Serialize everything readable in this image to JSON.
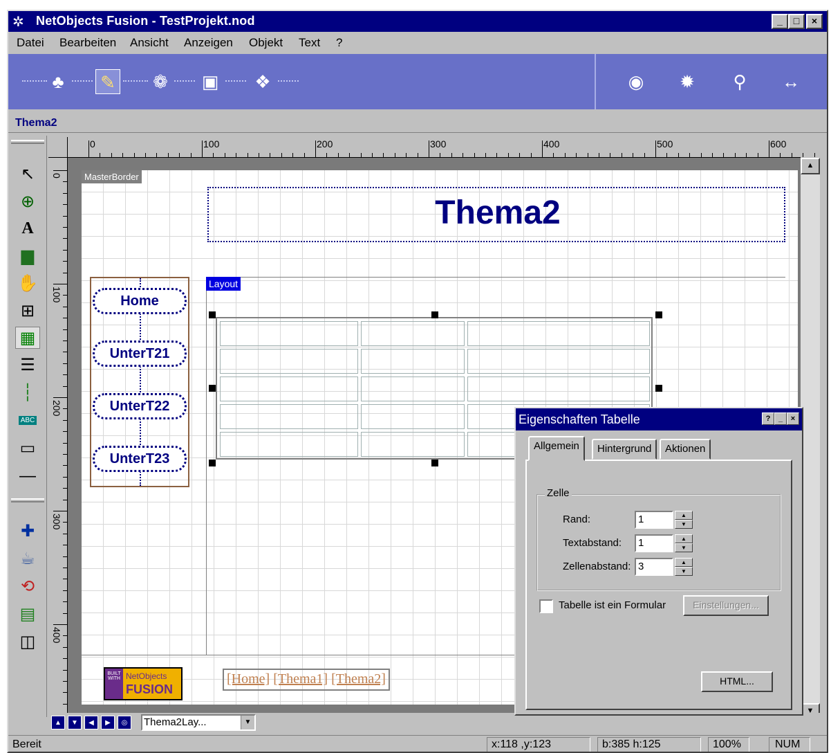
{
  "window": {
    "title": "NetObjects Fusion - TestProjekt.nod",
    "buttons": [
      "_",
      "□",
      "×"
    ]
  },
  "menu": [
    "Datei",
    "Bearbeiten",
    "Ansicht",
    "Anzeigen",
    "Objekt",
    "Text",
    "?"
  ],
  "toolbar": {
    "left_icons": [
      "site-view-icon",
      "page-view-icon",
      "style-view-icon",
      "assets-view-icon",
      "publish-view-icon"
    ],
    "right_icons": [
      "preview-icon",
      "settings-icon",
      "search-icon",
      "navigate-icon"
    ]
  },
  "page_name": "Thema2",
  "ruler": {
    "h_labels": [
      "0",
      "100",
      "200",
      "300",
      "400",
      "500",
      "600"
    ],
    "v_labels": [
      "0",
      "100",
      "200",
      "300",
      "400"
    ]
  },
  "canvas": {
    "master_border_label": "MasterBorder",
    "banner_text": "Thema2",
    "nav_buttons": [
      "Home",
      "UnterT21",
      "UnterT22",
      "UnterT23"
    ],
    "layout_label": "Layout",
    "logo": {
      "side": "BUILT WITH",
      "line1": "NetObjects",
      "line2": "FUSION"
    },
    "text_nav": [
      "[Home]",
      "[Thema1]",
      "[Thema2]"
    ]
  },
  "pagestrip": {
    "current_page": "Thema2Lay..."
  },
  "status": {
    "ready": "Bereit",
    "coords": "x:118 ,y:123",
    "size": "b:385 h:125",
    "zoom": "100%",
    "num": "NUM"
  },
  "dialog": {
    "title": "Eigenschaften Tabelle",
    "tabs": [
      "Allgemein",
      "Hintergrund",
      "Aktionen"
    ],
    "group_title": "Zelle",
    "fields": [
      {
        "label": "Rand:",
        "value": "1"
      },
      {
        "label": "Textabstand:",
        "value": "1"
      },
      {
        "label": "Zellenabstand:",
        "value": "3"
      }
    ],
    "checkbox_label": "Tabelle ist ein Formular",
    "settings_button": "Einstellungen...",
    "html_button": "HTML..."
  }
}
